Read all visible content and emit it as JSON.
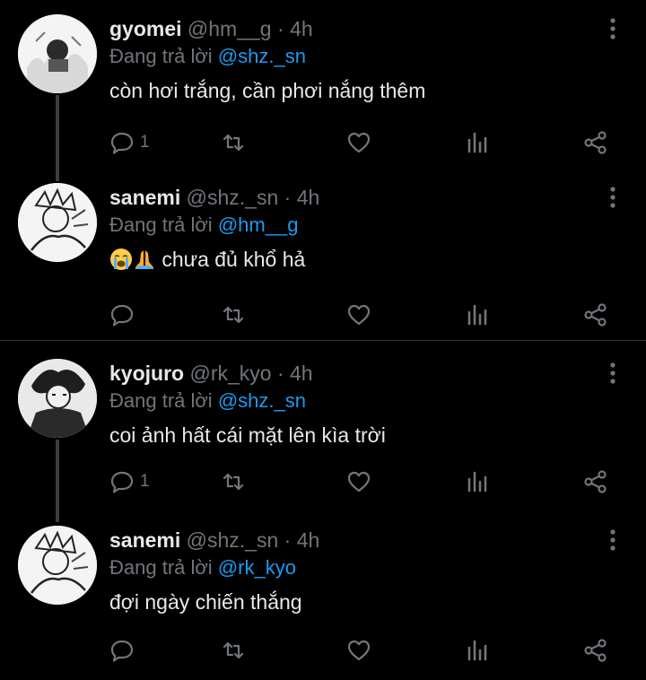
{
  "replying_prefix": "Đang trả lời",
  "colors": {
    "background": "#000000",
    "text": "#e7e9ea",
    "muted": "#71767b",
    "mention": "#1d9bf0",
    "divider": "#2f3336"
  },
  "tweets": [
    {
      "name": "gyomei",
      "handle": "@hm__g",
      "dot": "·",
      "time": "4h",
      "reply_to": "@shz._sn",
      "text": "còn hơi trắng, cần phơi nắng thêm",
      "reply_count": "1",
      "icons": [
        "reply-icon",
        "retweet-icon",
        "like-icon",
        "views-icon",
        "share-icon",
        "more-icon"
      ]
    },
    {
      "name": "sanemi",
      "handle": "@shz._sn",
      "dot": "·",
      "time": "4h",
      "reply_to": "@hm__g",
      "text": "chưa đủ khổ hả",
      "emoji": [
        "loudly-crying-face",
        "folded-hands"
      ],
      "reply_count": ""
    },
    {
      "name": "kyojuro",
      "handle": "@rk_kyo",
      "dot": "·",
      "time": "4h",
      "reply_to": "@shz._sn",
      "text": "coi ảnh hất cái mặt lên kìa trời",
      "reply_count": "1"
    },
    {
      "name": "sanemi",
      "handle": "@shz._sn",
      "dot": "·",
      "time": "4h",
      "reply_to": "@rk_kyo",
      "text": "đợi ngày chiến thắng",
      "reply_count": ""
    }
  ]
}
